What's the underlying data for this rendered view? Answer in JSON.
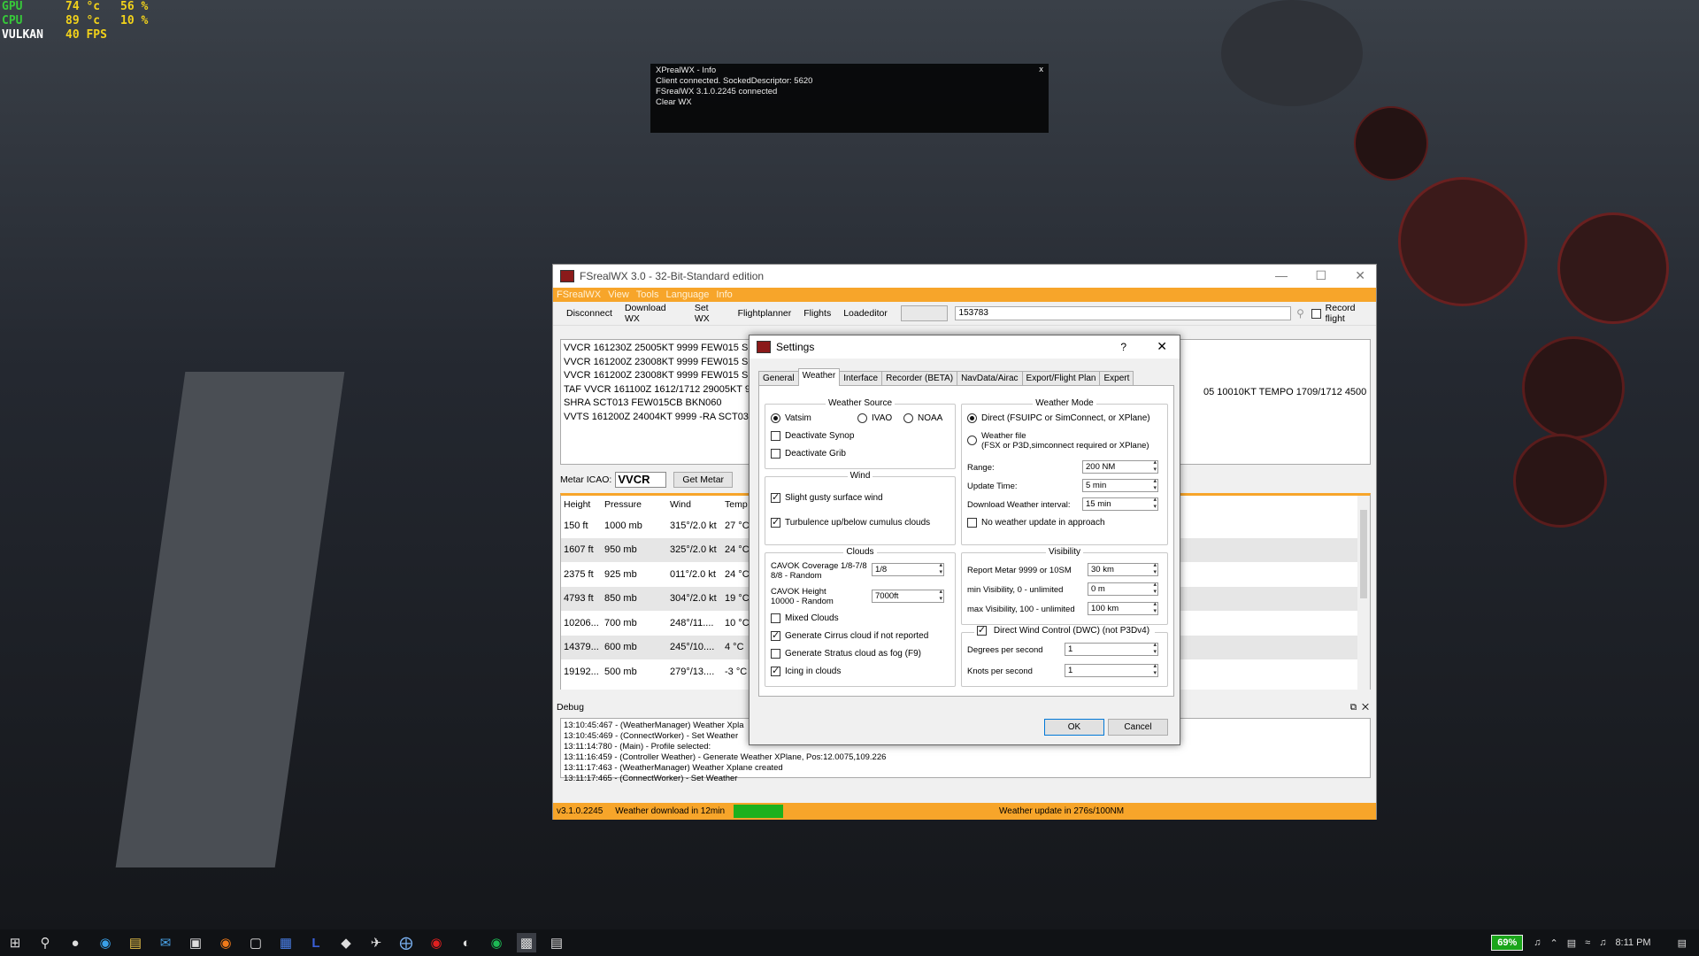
{
  "osd": {
    "rows": [
      {
        "label": "GPU",
        "v1": "74 °c",
        "v2": "56 %"
      },
      {
        "label": "CPU",
        "v1": "89 °c",
        "v2": "10 %"
      },
      {
        "label": "VULKAN",
        "v1": "40 FPS",
        "v2": ""
      }
    ]
  },
  "info_popup": {
    "title": "XPrealWX - Info",
    "lines": [
      "Client connected. SockedDescriptor: 5620",
      "FSrealWX 3.1.0.2245 connected",
      "Clear WX"
    ],
    "close": "x"
  },
  "main_window": {
    "title": "FSrealWX 3.0 - 32-Bit-Standard edition",
    "menu": [
      "FSrealWX",
      "View",
      "Tools",
      "Language",
      "Info"
    ],
    "toolbar": {
      "buttons": [
        "Disconnect",
        "Download WX",
        "Set WX",
        "Flightplanner",
        "Flights",
        "Loadeditor"
      ],
      "search_value": "153783",
      "record_label": "Record flight"
    },
    "metar_lines": [
      "VVCR 161230Z 25005KT 9999 FEW015 SCT",
      "VVCR 161200Z 23008KT 9999 FEW015 SCT",
      "VVCR 161200Z 23008KT 9999 FEW015 SCT",
      "TAF VVCR 161100Z 1612/1712 29005KT 99",
      "SHRA SCT013 FEW015CB BKN060",
      "VVTS 161200Z 24004KT 9999 -RA SCT033 E"
    ],
    "metar_extra": "05 10010KT    TEMPO 1709/1712 4500",
    "metar_icao_label": "Metar ICAO:",
    "metar_icao_value": "VVCR",
    "get_metar": "Get Metar",
    "table": {
      "headers": [
        "Height",
        "Pressure",
        "Wind",
        "Temp"
      ],
      "rows": [
        [
          "150 ft",
          "1000 mb",
          "315°/2.0 kt",
          "27 °C"
        ],
        [
          "1607 ft",
          "950 mb",
          "325°/2.0 kt",
          "24 °C"
        ],
        [
          "2375 ft",
          "925 mb",
          "011°/2.0 kt",
          "24 °C"
        ],
        [
          "4793 ft",
          "850 mb",
          "304°/2.0 kt",
          "19 °C"
        ],
        [
          "10206...",
          "700 mb",
          "248°/11....",
          "10 °C"
        ],
        [
          "14379...",
          "600 mb",
          "245°/10....",
          "4 °C"
        ],
        [
          "19192...",
          "500 mb",
          "279°/13....",
          "-3 °C"
        ]
      ]
    },
    "debug_title": "Debug",
    "debug_lines": [
      "13:10:45:467 - (WeatherManager)  Weather Xpla",
      "13:10:45:469 - (ConnectWorker) - Set Weather",
      "13:11:14:780 - (Main) - Profile selected:",
      "13:11:16:459 - (Controller Weather) - Generate Weather XPlane, Pos:12.0075,109.226",
      "13:11:17:463 - (WeatherManager)  Weather Xplane created",
      "13:11:17:465 - (ConnectWorker) - Set Weather"
    ],
    "status": {
      "version": "v3.1.0.2245",
      "download": "Weather download in 12min",
      "progress": 1.0,
      "update": "Weather update in 276s/100NM"
    }
  },
  "settings": {
    "title": "Settings",
    "help": "?",
    "tabs": [
      "General",
      "Weather",
      "Interface",
      "Recorder (BETA)",
      "NavData/Airac",
      "Export/Flight Plan",
      "Expert"
    ],
    "active_tab": "Weather",
    "weather_source": {
      "title": "Weather Source",
      "options": [
        "Vatsim",
        "IVAO",
        "NOAA"
      ],
      "selected": "Vatsim",
      "deactivate_synop": "Deactivate Synop",
      "deactivate_grib": "Deactivate Grib"
    },
    "wind": {
      "title": "Wind",
      "gusty": "Slight gusty surface wind",
      "turbulence": "Turbulence up/below cumulus clouds"
    },
    "clouds": {
      "title": "Clouds",
      "cavok_coverage_label1": "CAVOK Coverage 1/8-7/8",
      "cavok_coverage_label2": "8/8 - Random",
      "cavok_coverage_value": "1/8",
      "cavok_height_label1": "CAVOK Height",
      "cavok_height_label2": "10000 - Random",
      "cavok_height_value": "7000ft",
      "mixed": "Mixed Clouds",
      "cirrus": "Generate Cirrus cloud if not reported",
      "stratus": "Generate Stratus cloud as fog (F9)",
      "icing": "Icing in clouds"
    },
    "weather_mode": {
      "title": "Weather Mode",
      "direct": "Direct (FSUIPC or SimConnect, or XPlane)",
      "file1": "Weather file",
      "file2": "(FSX or P3D,simconnect required or XPlane)",
      "range_label": "Range:",
      "range_value": "200 NM",
      "update_label": "Update Time:",
      "update_value": "5 min",
      "interval_label": "Download Weather interval:",
      "interval_value": "15 min",
      "no_update": "No weather update in approach"
    },
    "visibility": {
      "title": "Visibility",
      "report_label": "Report Metar 9999 or 10SM",
      "report_value": "30 km",
      "min_label": "min Visibility, 0 - unlimited",
      "min_value": "0 m",
      "max_label": "max Visibility, 100 - unlimited",
      "max_value": "100 km"
    },
    "dwc": {
      "title": "Direct Wind Control (DWC) (not P3Dv4)",
      "deg_label": "Degrees per second",
      "deg_value": "1",
      "knots_label": "Knots per second",
      "knots_value": "1"
    },
    "ok": "OK",
    "cancel": "Cancel"
  },
  "taskbar": {
    "battery": "69%",
    "time": "8:11 PM"
  }
}
